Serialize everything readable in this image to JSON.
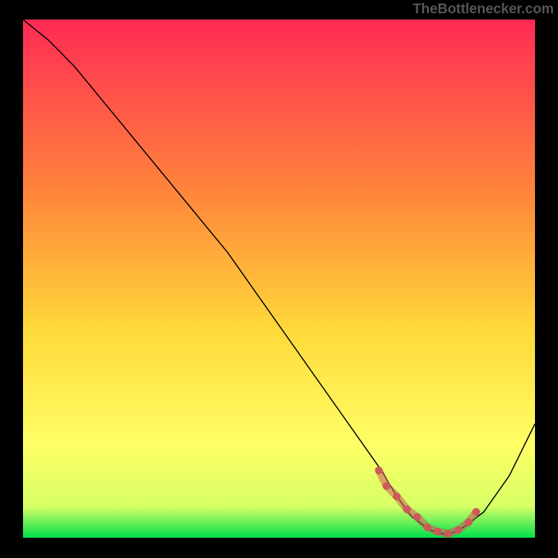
{
  "watermark": "TheBottlenecker.com",
  "chart_data": {
    "type": "line",
    "title": "",
    "xlabel": "",
    "ylabel": "",
    "xlim": [
      0,
      100
    ],
    "ylim": [
      0,
      100
    ],
    "legend": false,
    "background": {
      "type": "vertical-gradient",
      "stops": [
        {
          "offset": 0,
          "color": "#ff2a55"
        },
        {
          "offset": 35,
          "color": "#ff8a3a"
        },
        {
          "offset": 60,
          "color": "#ffd93a"
        },
        {
          "offset": 82,
          "color": "#ffff66"
        },
        {
          "offset": 94,
          "color": "#d6ff66"
        },
        {
          "offset": 100,
          "color": "#00e04a"
        }
      ]
    },
    "series": [
      {
        "name": "bottleneck-curve",
        "color": "#000000",
        "width": 1.6,
        "x": [
          0,
          5,
          10,
          15,
          20,
          25,
          30,
          35,
          40,
          45,
          50,
          55,
          60,
          65,
          70,
          73,
          76,
          79.5,
          83,
          86,
          90,
          95,
          100
        ],
        "y": [
          100,
          96,
          91,
          85,
          79,
          73,
          67,
          61,
          55,
          48,
          41,
          34,
          27,
          20,
          13,
          8,
          4,
          1.5,
          0.5,
          2,
          5,
          12,
          22
        ]
      }
    ],
    "highlight": {
      "name": "optimal-band",
      "color": "#cc5a5a",
      "marker_radius": 5.5,
      "x": [
        69.5,
        71,
        73,
        75,
        77,
        79,
        81,
        83,
        85,
        87,
        88.5
      ],
      "y": [
        13,
        10,
        8,
        5.5,
        4,
        2,
        1.2,
        0.8,
        1.5,
        3,
        5
      ]
    }
  }
}
